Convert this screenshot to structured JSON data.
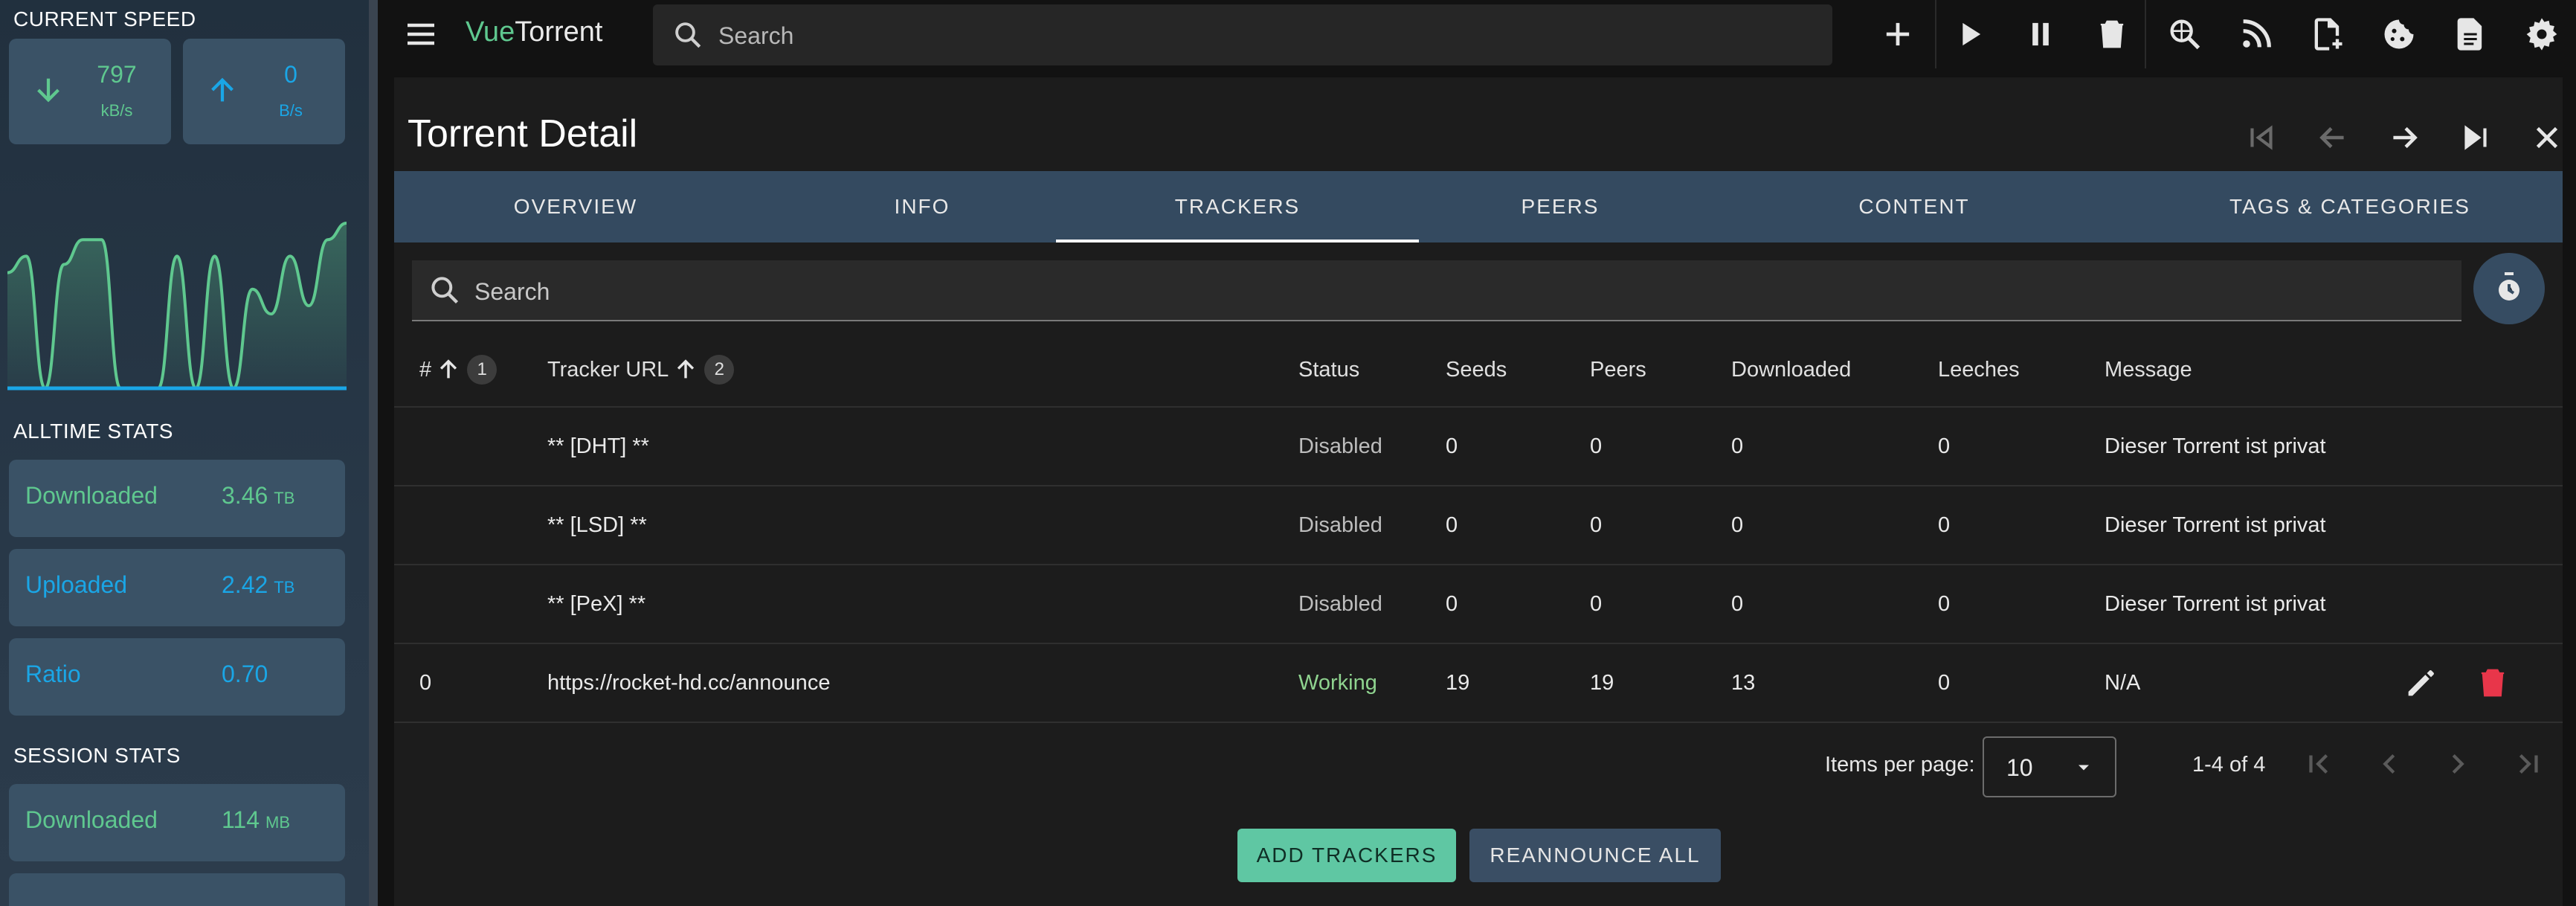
{
  "sidebar": {
    "current_speed_title": "CURRENT SPEED",
    "download": {
      "value": "797",
      "unit": "kB/s"
    },
    "upload": {
      "value": "0",
      "unit": "B/s"
    },
    "alltime_title": "ALLTIME STATS",
    "alltime": [
      {
        "label": "Downloaded",
        "value": "3.46",
        "unit": "TB"
      },
      {
        "label": "Uploaded",
        "value": "2.42",
        "unit": "TB"
      },
      {
        "label": "Ratio",
        "value": "0.70",
        "unit": ""
      }
    ],
    "session_title": "SESSION STATS",
    "session": [
      {
        "label": "Downloaded",
        "value": "114",
        "unit": "MB"
      }
    ],
    "colors": {
      "download": "#5fc88f",
      "upload": "#1aa6e6"
    }
  },
  "topbar": {
    "brand_prefix": "Vue",
    "brand_suffix": "Torrent",
    "search_placeholder": "Search",
    "icons": [
      "add-icon",
      "play-icon",
      "pause-icon",
      "delete-icon",
      "search-plugin-icon",
      "rss-icon",
      "add-file-icon",
      "cookie-icon",
      "logs-icon",
      "settings-icon"
    ]
  },
  "detail": {
    "title": "Torrent Detail",
    "tabs": [
      "OVERVIEW",
      "INFO",
      "TRACKERS",
      "PEERS",
      "CONTENT",
      "TAGS & CATEGORIES"
    ],
    "active_tab": "TRACKERS",
    "search_placeholder": "Search"
  },
  "table": {
    "headers": {
      "index": "#",
      "index_sort_order": "1",
      "url": "Tracker URL",
      "url_sort_order": "2",
      "status": "Status",
      "seeds": "Seeds",
      "peers": "Peers",
      "downloaded": "Downloaded",
      "leeches": "Leeches",
      "message": "Message"
    },
    "rows": [
      {
        "index": "",
        "url": "** [DHT] **",
        "status": "Disabled",
        "seeds": "0",
        "peers": "0",
        "downloaded": "0",
        "leeches": "0",
        "message": "Dieser Torrent ist privat"
      },
      {
        "index": "",
        "url": "** [LSD] **",
        "status": "Disabled",
        "seeds": "0",
        "peers": "0",
        "downloaded": "0",
        "leeches": "0",
        "message": "Dieser Torrent ist privat"
      },
      {
        "index": "",
        "url": "** [PeX] **",
        "status": "Disabled",
        "seeds": "0",
        "peers": "0",
        "downloaded": "0",
        "leeches": "0",
        "message": "Dieser Torrent ist privat"
      },
      {
        "index": "0",
        "url": "https://rocket-hd.cc/announce",
        "status": "Working",
        "seeds": "19",
        "peers": "19",
        "downloaded": "13",
        "leeches": "0",
        "message": "N/A"
      }
    ]
  },
  "pagination": {
    "items_per_page_label": "Items per page:",
    "items_per_page": "10",
    "range": "1-4 of 4"
  },
  "actions": {
    "add_trackers": "ADD TRACKERS",
    "reannounce_all": "REANNOUNCE ALL"
  },
  "chart_data": {
    "type": "line",
    "series": [
      {
        "values": [
          0.7,
          0.8,
          0.0,
          0.75,
          0.9,
          0.9,
          0.0,
          0.0,
          0.0,
          0.8,
          0.0,
          0.8,
          0.0,
          0.6,
          0.45,
          0.8,
          0.5,
          0.9,
          1.0
        ]
      },
      {
        "values": [
          0,
          0,
          0,
          0,
          0,
          0,
          0,
          0,
          0,
          0,
          0,
          0,
          0,
          0,
          0,
          0,
          0,
          0,
          0
        ]
      }
    ]
  }
}
